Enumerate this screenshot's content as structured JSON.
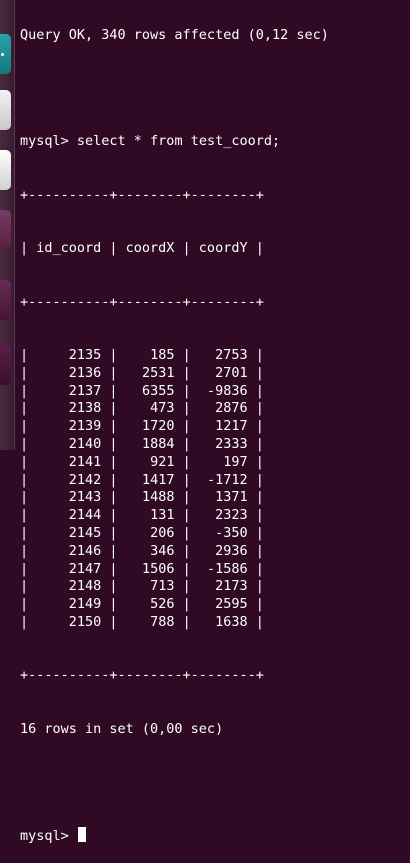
{
  "terminal": {
    "status_line": "Query OK, 340 rows affected (0,12 sec)",
    "command_prompt": "mysql> ",
    "command_text": "select * from test_coord;",
    "border_line": "+----------+--------+--------+",
    "header_line": "| id_coord | coordX | coordY |",
    "columns": [
      "id_coord",
      "coordX",
      "coordY"
    ],
    "rows": [
      [
        "2135",
        "185",
        "2753"
      ],
      [
        "2136",
        "2531",
        "2701"
      ],
      [
        "2137",
        "6355",
        "-9836"
      ],
      [
        "2138",
        "473",
        "2876"
      ],
      [
        "2139",
        "1720",
        "1217"
      ],
      [
        "2140",
        "1884",
        "2333"
      ],
      [
        "2141",
        "921",
        "197"
      ],
      [
        "2142",
        "1417",
        "-1712"
      ],
      [
        "2143",
        "1488",
        "1371"
      ],
      [
        "2144",
        "131",
        "2323"
      ],
      [
        "2145",
        "206",
        "-350"
      ],
      [
        "2146",
        "346",
        "2936"
      ],
      [
        "2147",
        "1506",
        "-1586"
      ],
      [
        "2148",
        "713",
        "2173"
      ],
      [
        "2149",
        "526",
        "2595"
      ],
      [
        "2150",
        "788",
        "1638"
      ]
    ],
    "summary_line": "16 rows in set (0,00 sec)",
    "final_prompt": "mysql> "
  },
  "colors": {
    "background": "#300a24",
    "text": "#ffffff"
  }
}
